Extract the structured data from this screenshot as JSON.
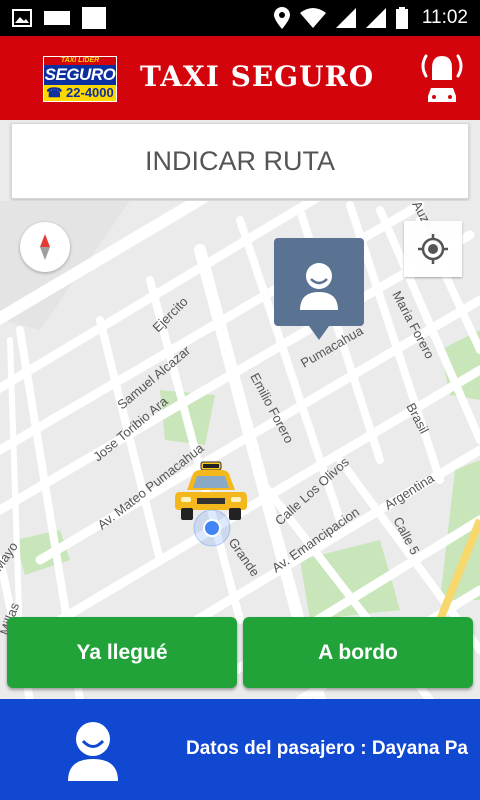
{
  "status_bar": {
    "time": "11:02",
    "icons": [
      "image-icon",
      "rectangle-icon",
      "square-icon",
      "location-icon",
      "wifi-icon",
      "signal-icon",
      "signal-icon",
      "battery-icon"
    ]
  },
  "app_bar": {
    "title": "TAXI SEGURO",
    "logo": {
      "top_text": "TAXI LIDER",
      "brand": "SEGURO",
      "phone": "☎ 22-4000"
    },
    "alarm_icon": "alarm-car-icon"
  },
  "route": {
    "label": "INDICAR RUTA"
  },
  "map": {
    "street_labels": [
      "Ejercito",
      "Samuel Alcazar",
      "Jose Toribio Ara",
      "Av. Mateo Pumacahua",
      "Emilio Forero",
      "Pumacahua",
      "Maria Forero",
      "Brasil",
      "Calle Los Olivos",
      "Av. Emancipacion",
      "Argentina",
      "Calle 5",
      "Grande",
      "Mayo",
      "Millas",
      "Auza Ace"
    ],
    "colors": {
      "background": "#ebebeb",
      "roads": "#ffffff",
      "parks": "#c8e6b9",
      "highway": "#f6d86c"
    }
  },
  "actions": {
    "arrived_label": "Ya llegué",
    "onboard_label": "A bordo",
    "color": "#21a339"
  },
  "bottom_bar": {
    "passenger_text": "Datos del pasajero : Dayana Pa",
    "color": "#1148d2"
  },
  "brand_colors": {
    "primary_red": "#d4040c",
    "yellow": "#ffd800"
  }
}
